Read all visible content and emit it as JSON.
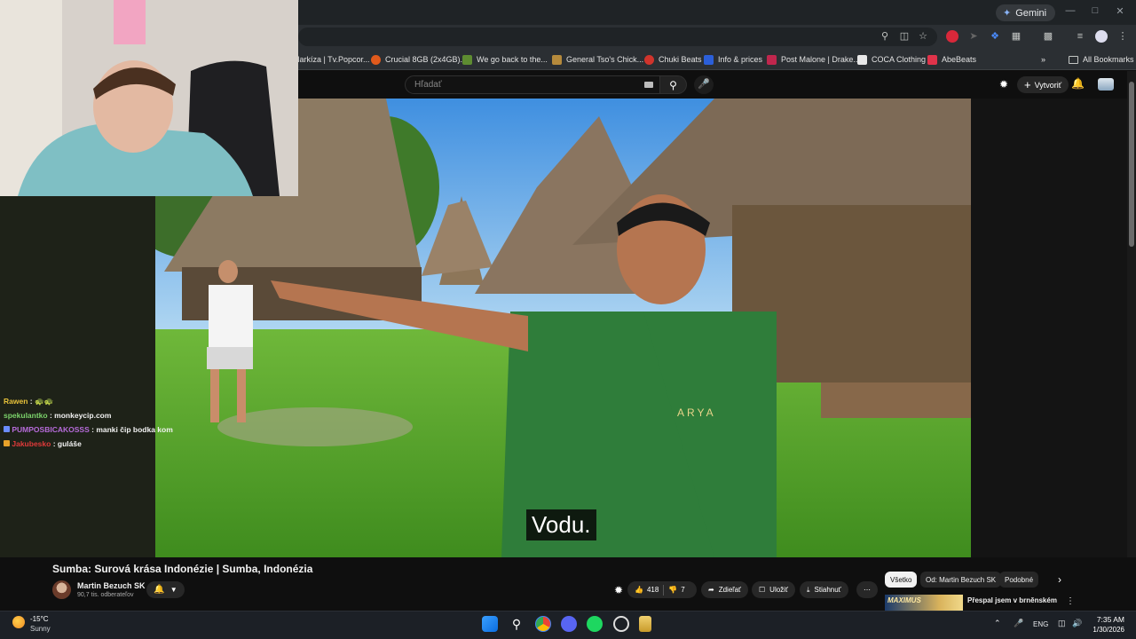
{
  "browser": {
    "gemini_label": "Gemini",
    "window_controls": [
      "—",
      "□",
      "✕"
    ],
    "bookmarks": [
      {
        "label": "Markíza | Tv.Popcor...",
        "color": "#4a9e4a"
      },
      {
        "label": "Crucial 8GB (2x4GB)...",
        "color": "#e05a1c"
      },
      {
        "label": "We go back to the...",
        "color": "#5e8c31"
      },
      {
        "label": "General Tso's Chick...",
        "color": "#b58a3c"
      },
      {
        "label": "Chuki Beats",
        "color": "#d0342c"
      },
      {
        "label": "Info & prices",
        "color": "#2b5fd9"
      },
      {
        "label": "Post Malone | Drake...",
        "color": "#c0264d"
      },
      {
        "label": "COCA Clothing",
        "color": "#e8e8e8"
      },
      {
        "label": "AbeBeats",
        "color": "#e0334a"
      }
    ],
    "more_bookmarks": "»",
    "all_bookmarks": "All Bookmarks"
  },
  "youtube": {
    "search_placeholder": "Hľadať",
    "create_label": "Vytvoriť",
    "subtitle": "Vodu."
  },
  "chat": [
    {
      "user": "Rawen",
      "sep": " :",
      "message": " 🐢🐢",
      "color": "#e8c23a"
    },
    {
      "user": "spekulantko",
      "sep": " :",
      "message": " monkeycip.com",
      "color": "#7cd36b"
    },
    {
      "user": "PUMPOSBICAKOSSS",
      "sep": " :",
      "message": " manki čip bodka kom",
      "color": "#b66bd9"
    },
    {
      "user": "Jakubesko",
      "sep": " :",
      "message": " guláše",
      "color": "#e03a3a"
    }
  ],
  "video": {
    "title": "Sumba: Surová krása Indonézie | Sumba, Indonézia",
    "channel": "Martin Bezuch SK",
    "subscribers": "90,7 tis. odberateľov",
    "likes": "418",
    "dislikes": "7",
    "share": "Zdieľať",
    "save": "Uložiť",
    "download": "Stiahnuť",
    "more": "⋯"
  },
  "chips": [
    {
      "label": "Všetko",
      "active": true
    },
    {
      "label": "Od: Martin Bezuch SK",
      "active": false
    },
    {
      "label": "Podobné",
      "active": false
    }
  ],
  "recommendation": {
    "thumb_text": "MAXIMUS",
    "title": "Přespal jsem v brněnském"
  },
  "taskbar": {
    "temp": "-15°C",
    "weather": "Sunny",
    "language": "ENG",
    "time": "7:35 AM",
    "date": "1/30/2026"
  }
}
